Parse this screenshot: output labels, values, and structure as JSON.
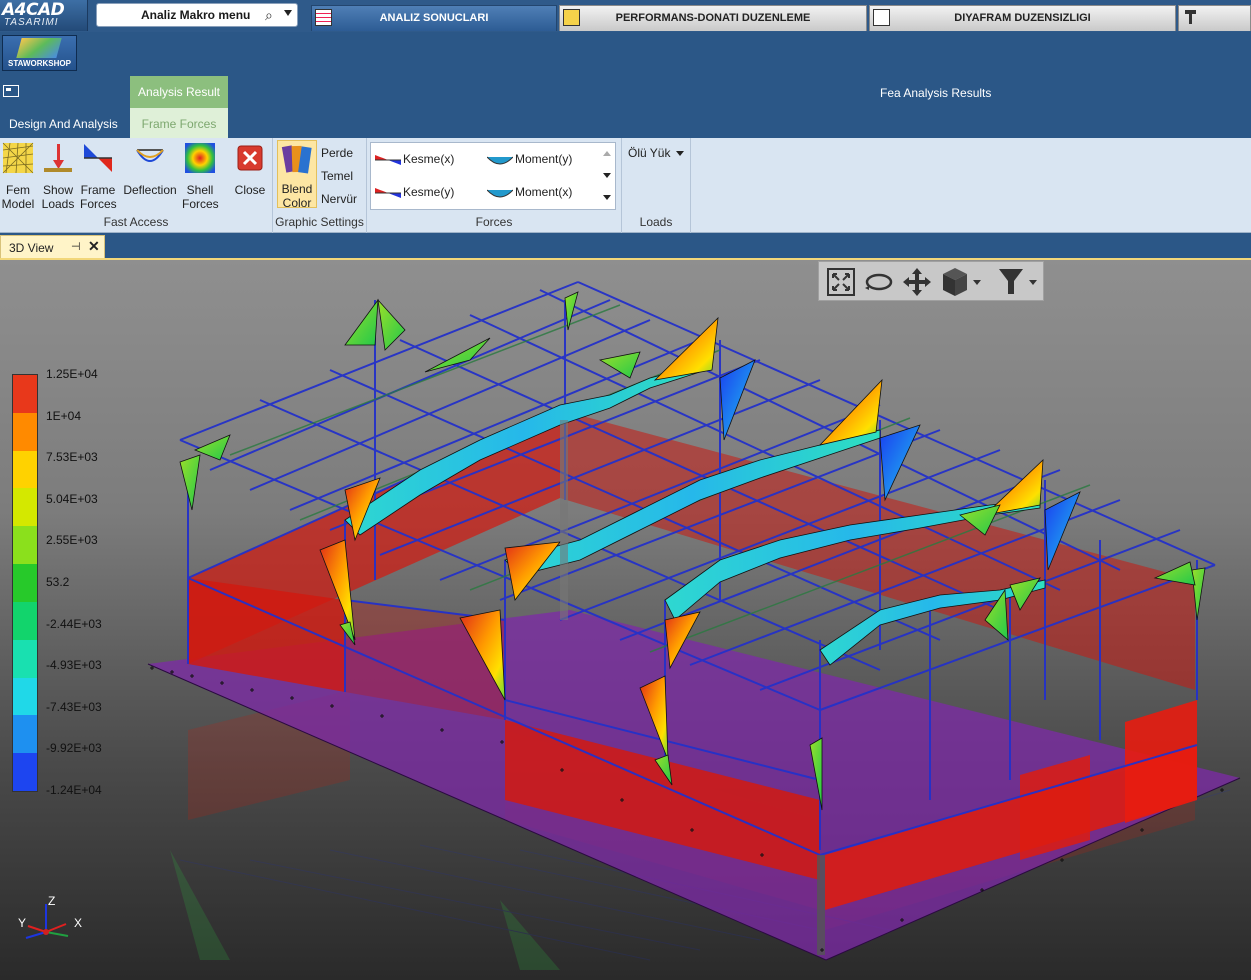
{
  "app": {
    "logo": "A4CAD",
    "logo_sub": "TASARIMI",
    "macro_label": "Analiz Makro menu"
  },
  "top_tabs": [
    {
      "label": "ANALIZ SONUCLARI",
      "active": true
    },
    {
      "label": "PERFORMANS-DONATI DUZENLEME",
      "active": false
    },
    {
      "label": "DIYAFRAM DUZENSIZLIGI",
      "active": false
    }
  ],
  "header": {
    "staworkshop_label": "STAWORKSHOP",
    "context_tab": "Analysis Result",
    "title": "Fea Analysis Results"
  },
  "ribbon_tabs": [
    {
      "label": "Design And Analysis"
    },
    {
      "label": "Frame Forces"
    }
  ],
  "ribbon": {
    "fast_access": {
      "label": "Fast Access",
      "buttons": [
        {
          "label_1": "Fem",
          "label_2": "Model",
          "icon": "fem-model-icon"
        },
        {
          "label_1": "Show",
          "label_2": "Loads",
          "icon": "show-loads-icon"
        },
        {
          "label_1": "Frame",
          "label_2": "Forces",
          "icon": "frame-forces-icon"
        },
        {
          "label_1": "Deflection",
          "label_2": "",
          "icon": "deflection-icon"
        },
        {
          "label_1": "Shell",
          "label_2": "Forces",
          "icon": "shell-forces-icon"
        },
        {
          "label_1": "Close",
          "label_2": "",
          "icon": "close-icon"
        }
      ]
    },
    "graphic_settings": {
      "label": "Graphic Settings",
      "blend_label_1": "Blend",
      "blend_label_2": "Color",
      "items": [
        "Perde",
        "Temel",
        "Nervür"
      ]
    },
    "forces": {
      "label": "Forces",
      "items": [
        "Kesme(x)",
        "Moment(y)",
        "Kesme(y)",
        "Moment(x)"
      ]
    },
    "loads": {
      "label": "Loads",
      "selected": "Ölü Yük"
    }
  },
  "doc_tab": {
    "label": "3D View",
    "pin": "⊣",
    "close": "✕"
  },
  "legend": {
    "values": [
      "1.25E+04",
      "1E+04",
      "7.53E+03",
      "5.04E+03",
      "2.55E+03",
      "53.2",
      "-2.44E+03",
      "-4.93E+03",
      "-7.43E+03",
      "-9.92E+03",
      "-1.24E+04"
    ],
    "colors": [
      "#e8381b",
      "#ff8a00",
      "#ffd200",
      "#d4e800",
      "#8be01c",
      "#27c92a",
      "#12d46c",
      "#19e0b0",
      "#20d8e8",
      "#1e90f0",
      "#1d45f0"
    ]
  },
  "axes": {
    "z": "Z",
    "y": "Y",
    "x": "X"
  }
}
